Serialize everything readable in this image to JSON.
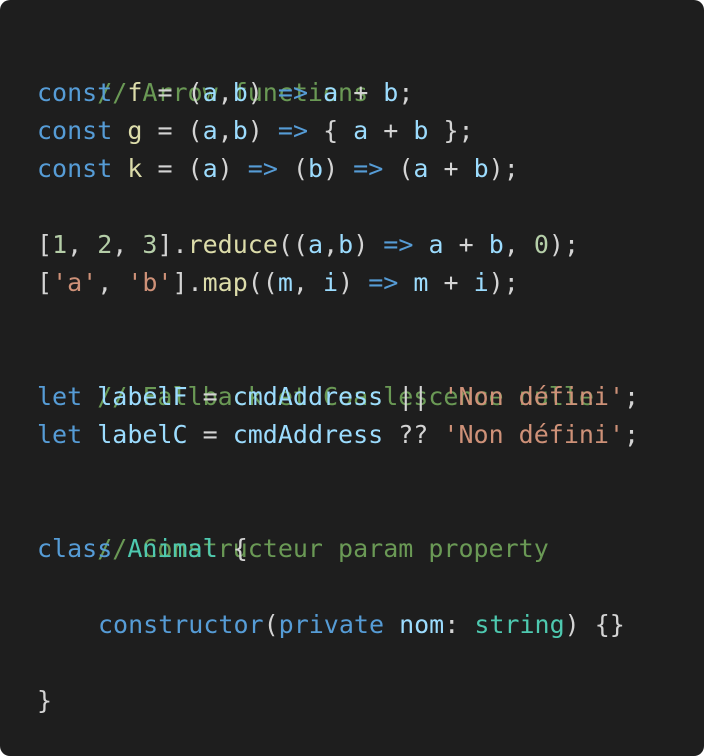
{
  "code": {
    "c1": "// Arrow functions",
    "l1": {
      "kw": "const",
      "name": "f",
      "a": " = (",
      "p1": "a",
      "comma": ",",
      "p2": "b",
      "b": ") ",
      "arrow": "=>",
      "sp": " ",
      "x": "a",
      "plus": " + ",
      "y": "b",
      "end": ";"
    },
    "l2": {
      "kw": "const",
      "name": "g",
      "a": " = (",
      "p1": "a",
      "comma": ",",
      "p2": "b",
      "b": ") ",
      "arrow": "=>",
      "open": " { ",
      "x": "a",
      "plus": " + ",
      "y": "b",
      "close": " };"
    },
    "l3": {
      "kw": "const",
      "name": "k",
      "a": " = (",
      "p1": "a",
      "b": ") ",
      "arrow1": "=>",
      "c": " (",
      "p2": "b",
      "d": ") ",
      "arrow2": "=>",
      "e": " (",
      "x": "a",
      "plus": " + ",
      "y": "b",
      "end": ");"
    },
    "l4": {
      "open": "[",
      "n1": "1",
      "s1": ", ",
      "n2": "2",
      "s2": ", ",
      "n3": "3",
      "close": "].",
      "method": "reduce",
      "a": "((",
      "p1": "a",
      "comma": ",",
      "p2": "b",
      "b": ") ",
      "arrow": "=>",
      "sp": " ",
      "x": "a",
      "plus": " + ",
      "y": "b",
      "s3": ", ",
      "n0": "0",
      "end": ");"
    },
    "l5": {
      "open": "[",
      "s1": "'a'",
      "sep": ", ",
      "s2": "'b'",
      "close": "].",
      "method": "map",
      "a": "((",
      "p1": "m",
      "comma": ", ",
      "p2": "i",
      "b": ") ",
      "arrow": "=>",
      "sp": " ",
      "x": "m",
      "plus": " + ",
      "y": "i",
      "end": ");"
    },
    "c2": "// Fallback et Coaslescence nulle",
    "l6": {
      "kw": "let",
      "name": "labelF",
      "eq": " = ",
      "src": "cmdAddress",
      "op": " || ",
      "str": "'Non défini'",
      "end": ";"
    },
    "l7": {
      "kw": "let",
      "name": "labelC",
      "eq": " = ",
      "src": "cmdAddress",
      "op": " ?? ",
      "str": "'Non défini'",
      "end": ";"
    },
    "c3": "// Constructeur param property",
    "l8": {
      "kw": "class",
      "name": "Animal",
      "open": " {"
    },
    "l9": {
      "ctor": "constructor",
      "a": "(",
      "mod": "private",
      "param": "nom",
      "colon": ": ",
      "type": "string",
      "end": ") {}"
    },
    "l10": {
      "close": "}"
    }
  }
}
